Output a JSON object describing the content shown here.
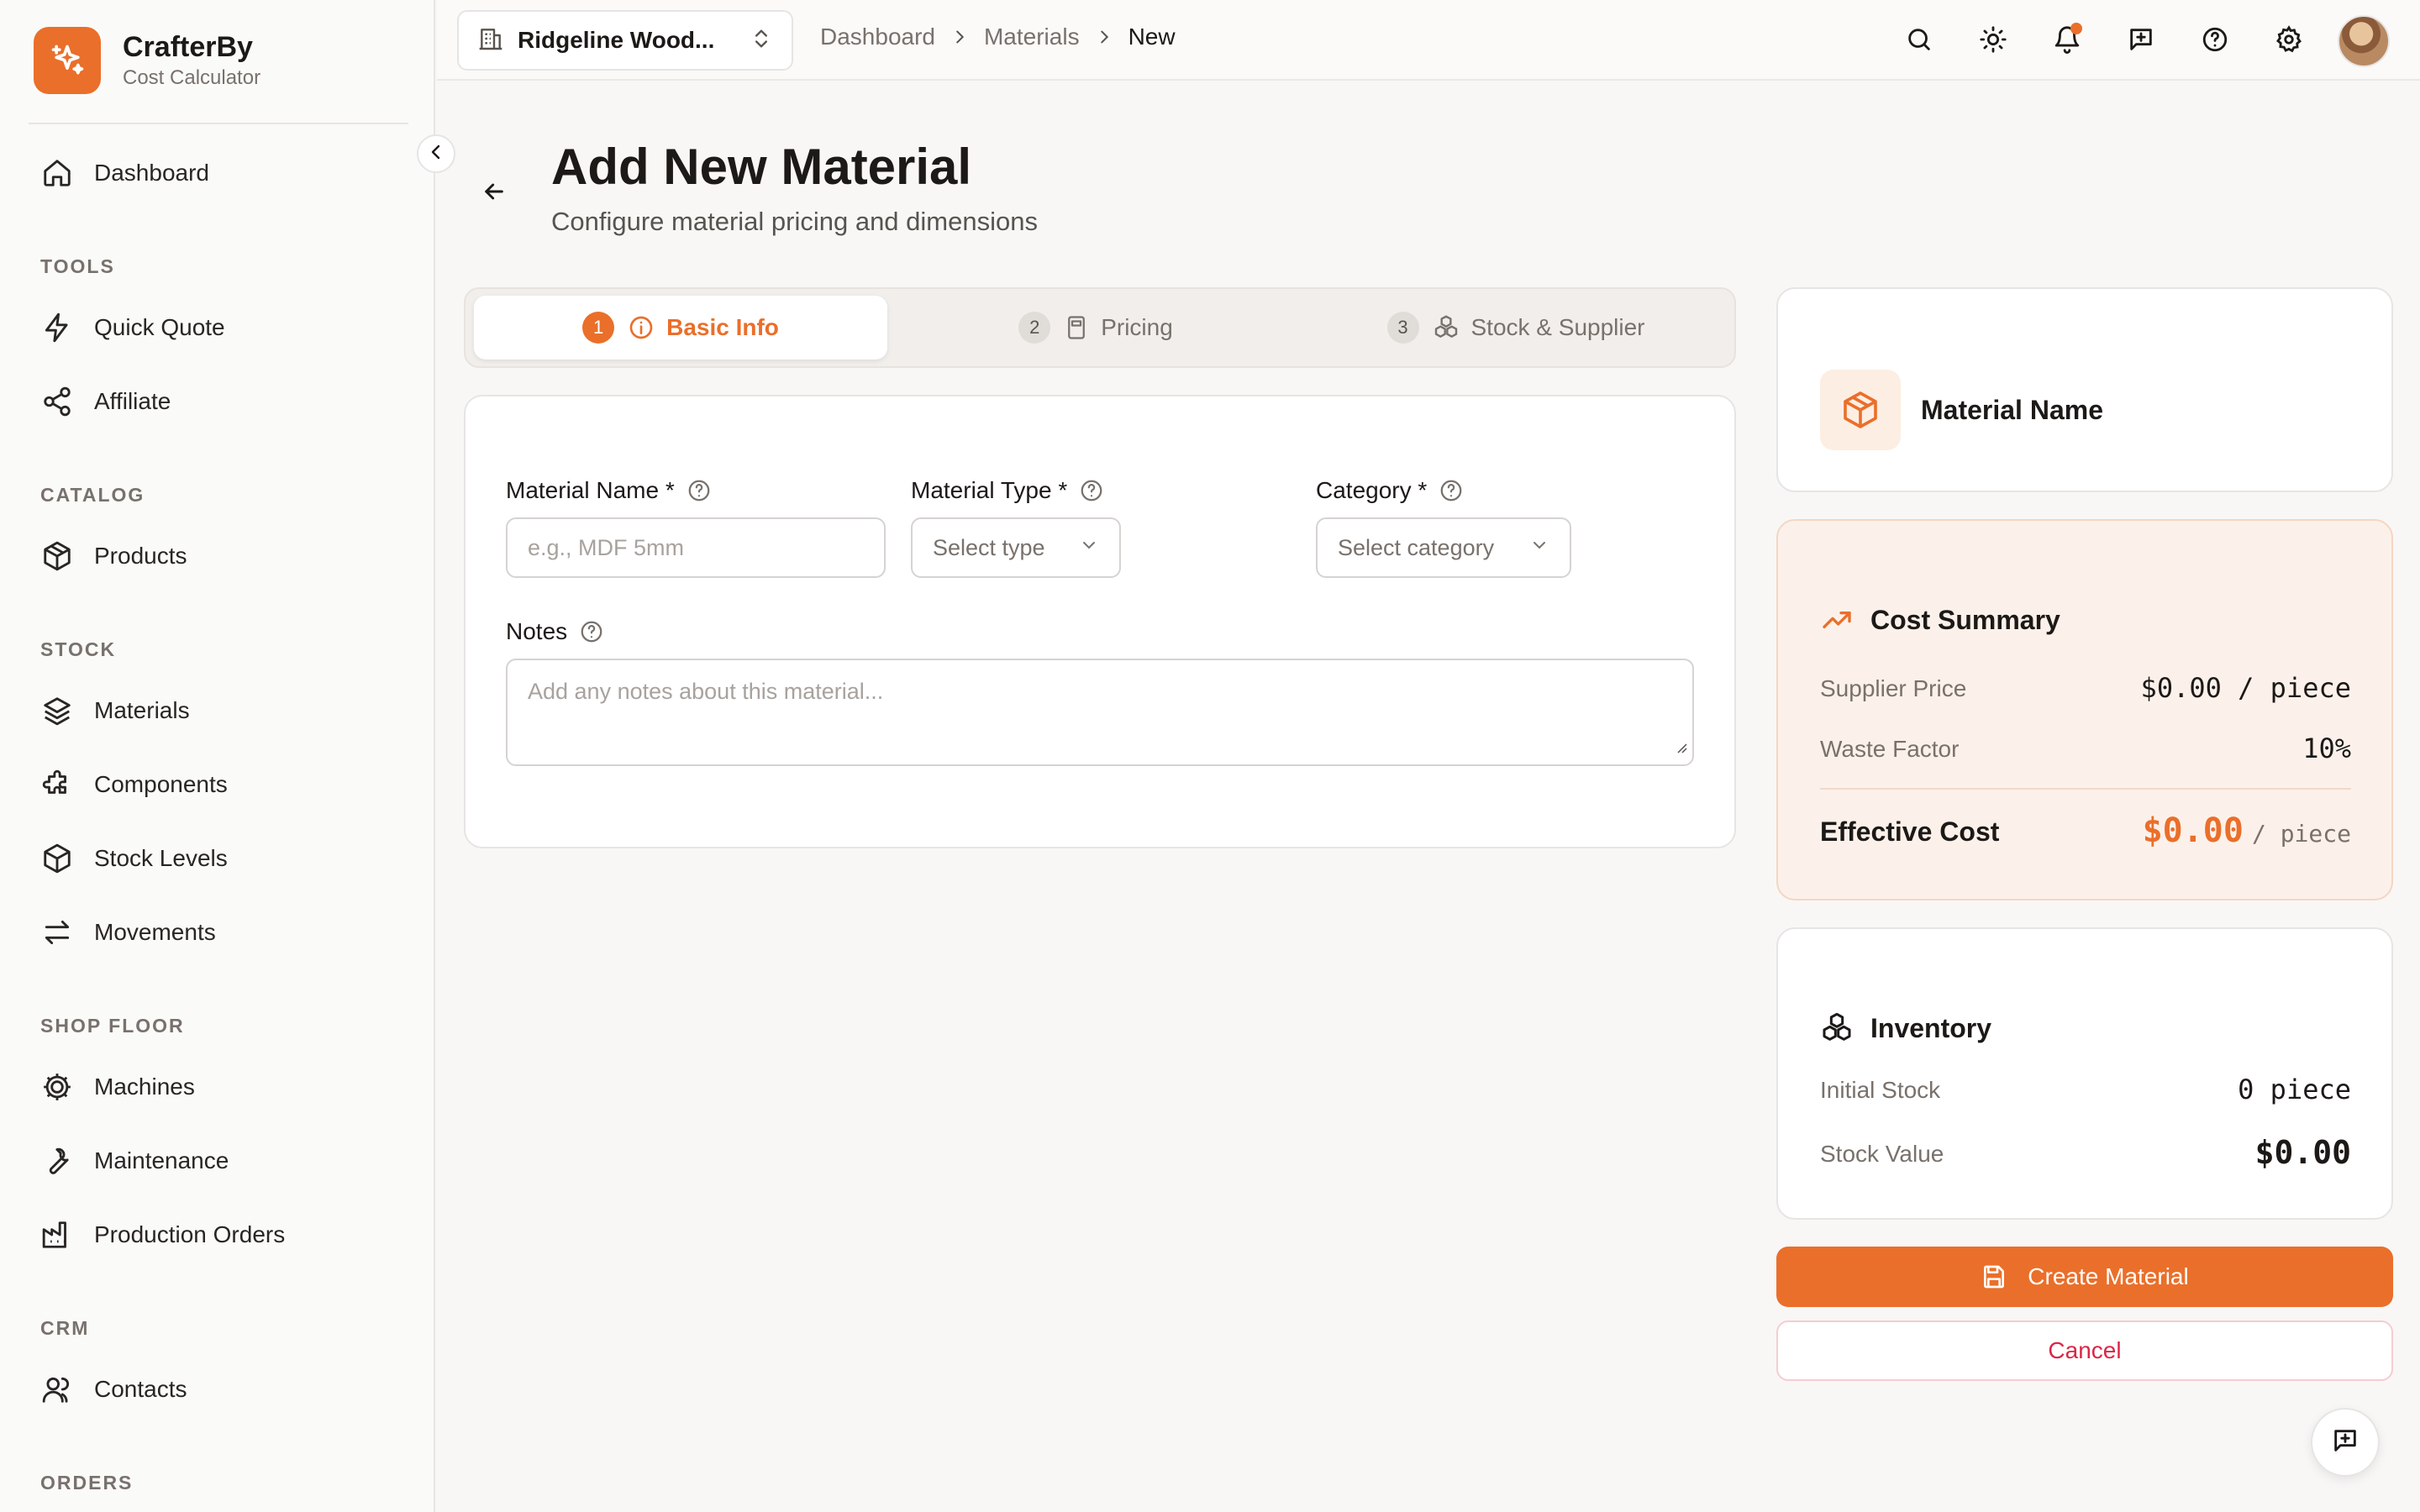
{
  "brand": {
    "name": "CrafterBy",
    "subtitle": "Cost Calculator"
  },
  "sidebar": {
    "top_item": "Dashboard",
    "sections": [
      {
        "title": "TOOLS",
        "items": [
          "Quick Quote",
          "Affiliate"
        ]
      },
      {
        "title": "CATALOG",
        "items": [
          "Products"
        ]
      },
      {
        "title": "STOCK",
        "items": [
          "Materials",
          "Components",
          "Stock Levels",
          "Movements"
        ]
      },
      {
        "title": "SHOP FLOOR",
        "items": [
          "Machines",
          "Maintenance",
          "Production Orders"
        ]
      },
      {
        "title": "CRM",
        "items": [
          "Contacts"
        ]
      },
      {
        "title": "ORDERS",
        "items": []
      }
    ]
  },
  "topbar": {
    "workspace": "Ridgeline Wood...",
    "breadcrumb": [
      "Dashboard",
      "Materials",
      "New"
    ]
  },
  "page": {
    "title": "Add New Material",
    "subtitle": "Configure material pricing and dimensions"
  },
  "tabs": [
    {
      "num": "1",
      "label": "Basic Info",
      "active": true
    },
    {
      "num": "2",
      "label": "Pricing",
      "active": false
    },
    {
      "num": "3",
      "label": "Stock & Supplier",
      "active": false
    }
  ],
  "form": {
    "material_name": {
      "label": "Material Name *",
      "placeholder": "e.g., MDF 5mm"
    },
    "material_type": {
      "label": "Material Type *",
      "placeholder": "Select type"
    },
    "category": {
      "label": "Category *",
      "placeholder": "Select category"
    },
    "notes": {
      "label": "Notes",
      "placeholder": "Add any notes about this material..."
    }
  },
  "preview": {
    "name": "Material Name"
  },
  "cost_summary": {
    "title": "Cost Summary",
    "supplier_price_label": "Supplier Price",
    "supplier_price_value": "$0.00 / piece",
    "waste_factor_label": "Waste Factor",
    "waste_factor_value": "10%",
    "effective_cost_label": "Effective Cost",
    "effective_cost_amount": "$0.00",
    "effective_cost_unit": "/ piece"
  },
  "inventory": {
    "title": "Inventory",
    "initial_stock_label": "Initial Stock",
    "initial_stock_value": "0 piece",
    "stock_value_label": "Stock Value",
    "stock_value_value": "$0.00"
  },
  "actions": {
    "create": "Create Material",
    "cancel": "Cancel"
  },
  "colors": {
    "accent": "#ea6f2a",
    "danger": "#dc2646",
    "text": "#1c1917",
    "muted": "#78716c"
  }
}
